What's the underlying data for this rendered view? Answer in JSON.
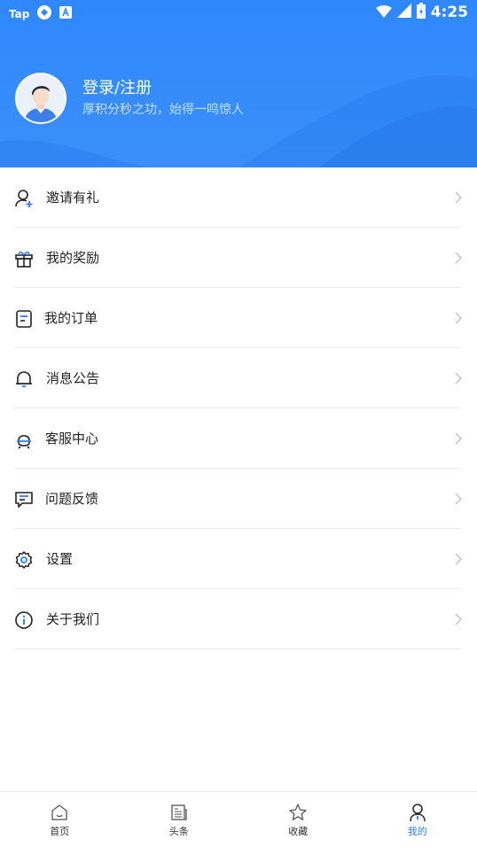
{
  "status_bar": {
    "left_label": "Tap",
    "time": "4:25"
  },
  "profile": {
    "login_label": "登录/注册",
    "motto": "厚积分秒之功，始得一鸣惊人"
  },
  "menu": [
    {
      "label": "邀请有礼",
      "icon": "invite-user-icon"
    },
    {
      "label": "我的奖励",
      "icon": "gift-icon"
    },
    {
      "label": "我的订单",
      "icon": "order-document-icon"
    },
    {
      "label": "消息公告",
      "icon": "bell-icon"
    },
    {
      "label": "客服中心",
      "icon": "customer-service-icon"
    },
    {
      "label": "问题反馈",
      "icon": "feedback-chat-icon"
    },
    {
      "label": "设置",
      "icon": "settings-gear-icon"
    },
    {
      "label": "关于我们",
      "icon": "info-icon"
    }
  ],
  "tabs": [
    {
      "label": "首页",
      "icon": "home-icon",
      "active": false
    },
    {
      "label": "头条",
      "icon": "news-icon",
      "active": false
    },
    {
      "label": "收藏",
      "icon": "star-icon",
      "active": false
    },
    {
      "label": "我的",
      "icon": "profile-icon",
      "active": true
    }
  ],
  "colors": {
    "header": "#2f88ff",
    "accent": "#2f7df7",
    "text": "#222222",
    "chevron": "#c4c4c4"
  }
}
